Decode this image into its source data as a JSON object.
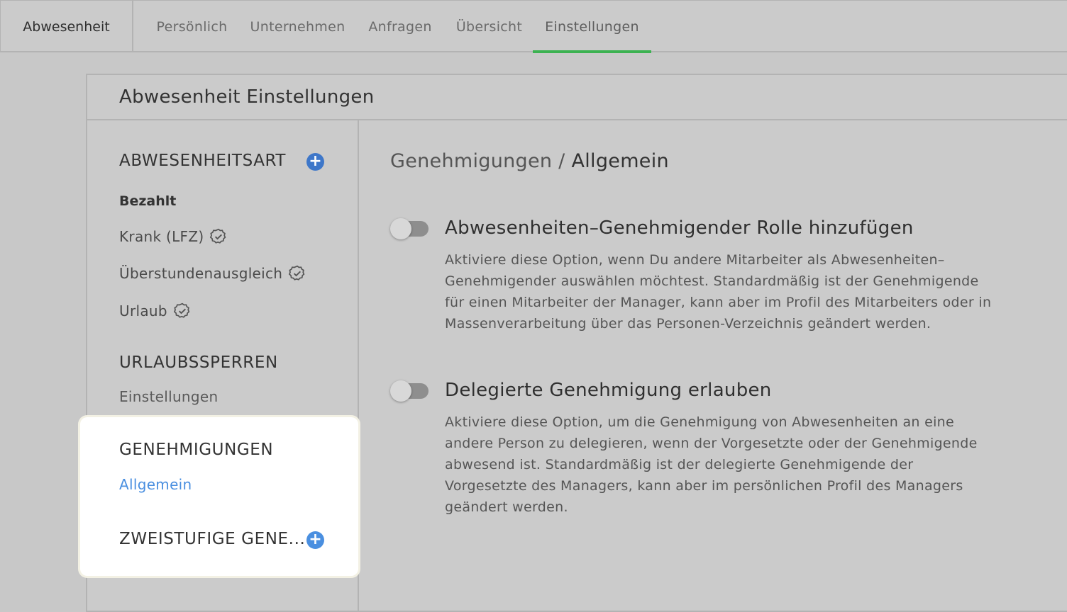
{
  "topbar": {
    "app_title": "Abwesenheit",
    "tabs": [
      {
        "label": "Persönlich"
      },
      {
        "label": "Unternehmen"
      },
      {
        "label": "Anfragen"
      },
      {
        "label": "Übersicht"
      },
      {
        "label": "Einstellungen",
        "active": true
      }
    ]
  },
  "card": {
    "title": "Abwesenheit Einstellungen"
  },
  "sidebar": {
    "absence_type_heading": "ABWESENHEITSART",
    "paid_heading": "Bezahlt",
    "absence_types": [
      {
        "label": "Krank (LFZ)",
        "icon": "verified-badge-icon"
      },
      {
        "label": "Überstundenausgleich",
        "icon": "verified-badge-icon"
      },
      {
        "label": "Urlaub",
        "icon": "verified-badge-icon"
      }
    ],
    "blackout_heading": "URLAUBSSPERREN",
    "blackout_link": "Einstellungen",
    "approvals_heading": "GENEHMIGUNGEN",
    "approvals_link": "Allgemein",
    "two_step_heading": "ZWEISTUFIGE GENE...",
    "plus_symbol": "+"
  },
  "main": {
    "breadcrumb_parent": "Genehmigungen /",
    "breadcrumb_current": "Allgemein",
    "options": [
      {
        "title": "Abwesenheiten–Genehmigender Rolle hinzufügen",
        "enabled": false,
        "lines": [
          "Aktiviere diese Option, wenn Du andere Mitarbeiter als Abwesenheiten–",
          "Genehmigender auswählen möchtest. Standardmäßig ist der Genehmigende",
          "für einen Mitarbeiter der Manager, kann aber im Profil des Mitarbeiters oder in",
          "Massenverarbeitung über das Personen-Verzeichnis geändert werden."
        ]
      },
      {
        "title": "Delegierte Genehmigung erlauben",
        "enabled": false,
        "lines": [
          "Aktiviere diese Option, um die Genehmigung von Abwesenheiten an eine",
          "andere Person zu delegieren, wenn der Vorgesetzte oder der Genehmigende",
          "abwesend ist. Standardmäßig ist der delegierte Genehmigende der",
          "Vorgesetzte des Managers, kann aber im persönlichen Profil des Managers",
          "geändert werden."
        ]
      }
    ]
  },
  "colors": {
    "accent_green": "#3cb251",
    "link_blue": "#4a8fe0",
    "plus_blue": "#3e77c9"
  }
}
